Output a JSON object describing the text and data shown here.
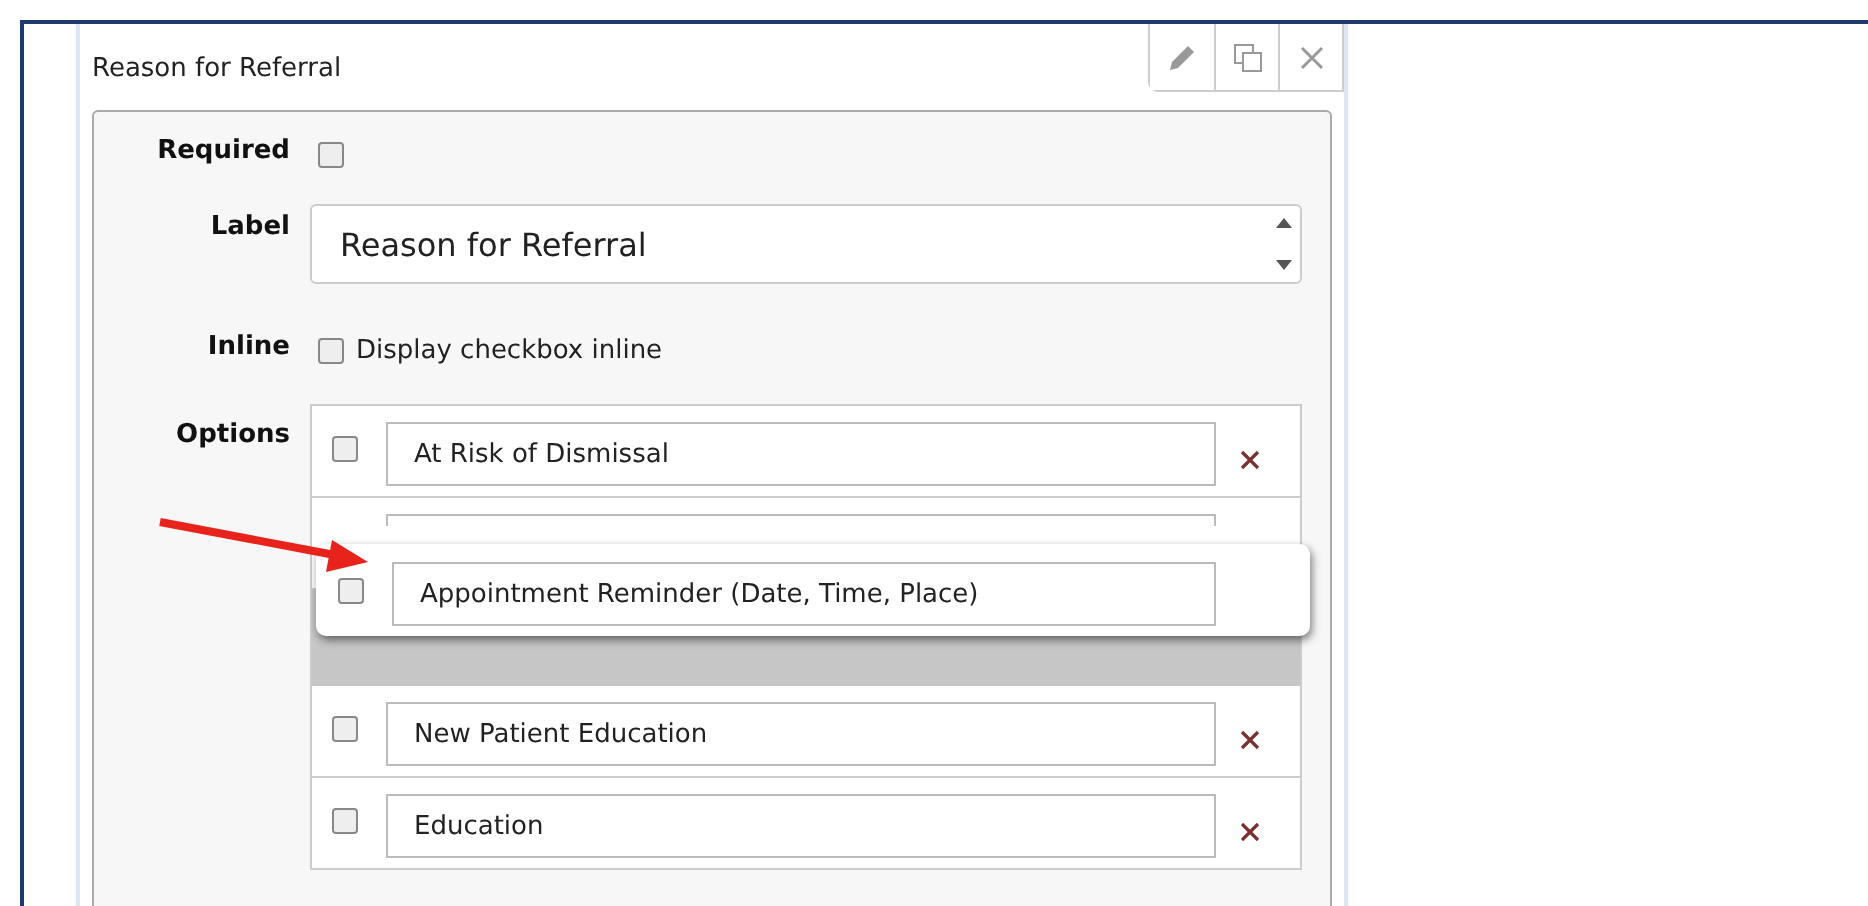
{
  "panel": {
    "title": "Reason for Referral"
  },
  "form": {
    "required": {
      "label": "Required",
      "checked": false
    },
    "label": {
      "label": "Label",
      "value": "Reason for Referral"
    },
    "inline": {
      "label": "Inline",
      "checked": false,
      "text": "Display checkbox inline"
    },
    "options": {
      "label": "Options",
      "rows": [
        {
          "kind": "option",
          "checked": false,
          "value": "At Risk of Dismissal"
        },
        {
          "kind": "ghost"
        },
        {
          "kind": "placeholder"
        },
        {
          "kind": "option",
          "checked": false,
          "value": "New Patient Education"
        },
        {
          "kind": "option",
          "checked": false,
          "value": "Education"
        }
      ],
      "dragged": {
        "checked": false,
        "value": "Appointment Reminder (Date, Time, Place)"
      }
    }
  }
}
